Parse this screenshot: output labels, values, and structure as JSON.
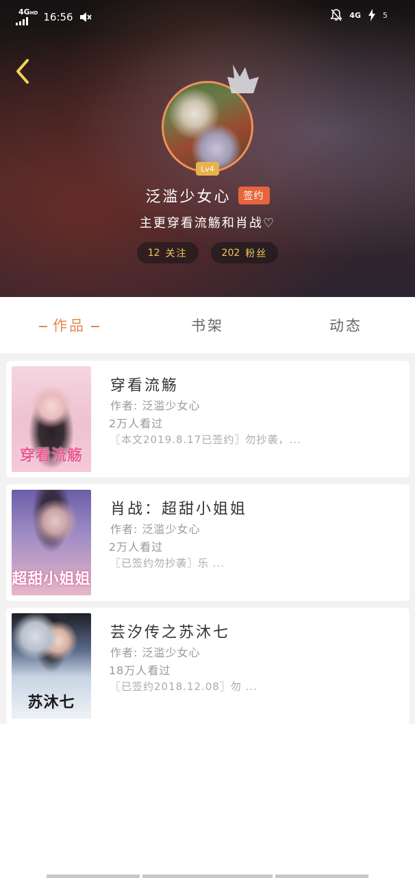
{
  "status_bar": {
    "network": "4G",
    "network_sub": "HD",
    "time": "16:56",
    "right_network": "4G",
    "battery": "5"
  },
  "profile": {
    "level": "Lv4",
    "name": "泛滥少女心",
    "signed_badge": "签约",
    "bio": "主更穿看流觞和肖战♡",
    "following_count": "12",
    "following_label": "关注",
    "fans_count": "202",
    "fans_label": "粉丝"
  },
  "tabs": [
    {
      "label": "作品",
      "active": true
    },
    {
      "label": "书架",
      "active": false
    },
    {
      "label": "动态",
      "active": false
    }
  ],
  "books": [
    {
      "title": "穿看流觞",
      "author": "作者: 泛滥少女心",
      "views": "2万人看过",
      "desc": "〖本文2019.8.17已签约〗勿抄袭，...",
      "cover_title": "穿看流觞"
    },
    {
      "title": "肖战：超甜小姐姐",
      "author": "作者: 泛滥少女心",
      "views": "2万人看过",
      "desc": "〖已签约勿抄袭〗乐 ...",
      "cover_title": "超甜小姐姐"
    },
    {
      "title": "芸汐传之苏沐七",
      "author": "作者: 泛滥少女心",
      "views": "18万人看过",
      "desc": "〖已签约2018.12.08〗勿 ...",
      "cover_title": "苏沐七"
    }
  ],
  "colors": {
    "accent": "#e8864a",
    "badge_orange": "#e8653b",
    "level_gold": "#e8b24c",
    "stat_gold": "#f2c95a"
  }
}
